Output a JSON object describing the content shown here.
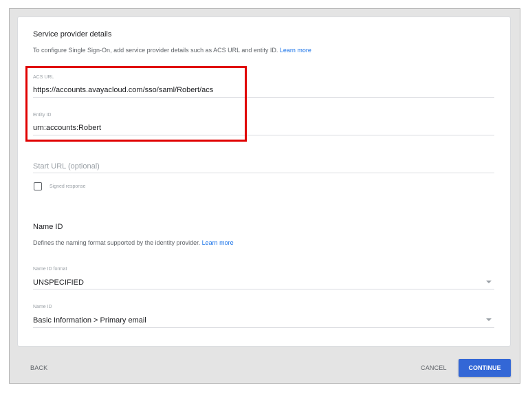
{
  "service_provider": {
    "title": "Service provider details",
    "description": "To configure Single Sign-On, add service provider details such as ACS URL and entity ID.",
    "learn_more": "Learn more"
  },
  "acs_url": {
    "label": "ACS URL",
    "value": "https://accounts.avayacloud.com/sso/saml/Robert/acs"
  },
  "entity_id": {
    "label": "Entity ID",
    "value": "urn:accounts:Robert"
  },
  "start_url": {
    "placeholder": "Start URL (optional)"
  },
  "signed_response": {
    "label": "Signed response",
    "checked": false
  },
  "name_id_section": {
    "title": "Name ID",
    "description": "Defines the naming format supported by the identity provider.",
    "learn_more": "Learn more"
  },
  "name_id_format": {
    "label": "Name ID format",
    "value": "UNSPECIFIED"
  },
  "name_id": {
    "label": "Name ID",
    "value": "Basic Information > Primary email"
  },
  "footer": {
    "back": "BACK",
    "cancel": "CANCEL",
    "continue": "CONTINUE"
  },
  "colors": {
    "accent": "#3367d6",
    "link": "#1a73e8",
    "highlight": "#e00000"
  }
}
